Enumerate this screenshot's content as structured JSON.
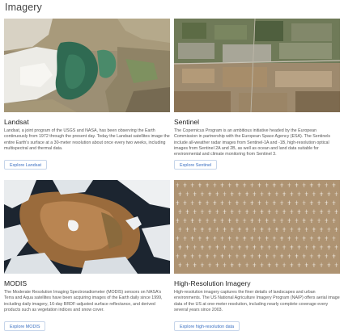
{
  "page": {
    "title": "Imagery"
  },
  "cards": [
    {
      "title": "Landsat",
      "image_subject": "Landsat satellite image of a lake with salt flats and green water",
      "description": "Landsat, a joint program of the USGS and NASA, has been observing the Earth continuously from 1972 through the present day. Today the Landsat satellites image the entire Earth's surface at a 30-meter resolution about once every two weeks, including multispectral and thermal data.",
      "button_label": "Explore Landsat"
    },
    {
      "title": "Sentinel",
      "image_subject": "Sentinel satellite image of a town with fields",
      "description": "The Copernicus Program is an ambitious initiative headed by the European Commission in partnership with the European Space Agency (ESA). The Sentinels include all-weather radar images from Sentinel-1A and -1B, high-resolution optical images from Sentinel 2A and 2B, as well as ocean and land data suitable for environmental and climate monitoring from Sentinel 3.",
      "button_label": "Explore Sentinel"
    },
    {
      "title": "MODIS",
      "image_subject": "MODIS satellite image of Africa and Europe with clouds",
      "description": "The Moderate Resolution Imaging Spectroradiometer (MODIS) sensors on NASA's Terra and Aqua satellites have been acquiring images of the Earth daily since 1999, including daily imagery, 16-day BRDF-adjusted surface reflectance, and derived products such as vegetation indices and snow cover.",
      "button_label": "Explore MODIS"
    },
    {
      "title": "High-Resolution Imagery",
      "image_subject": "High-resolution aerial image of an aircraft boneyard",
      "description": "High-resolution imagery captures the finer details of landscapes and urban environments. The US National Agriculture Imagery Program (NAIP) offers aerial image data of the US at one-meter resolution, including nearly complete coverage every several years since 2003.",
      "button_label": "Explore high-resolution data"
    }
  ],
  "colors": {
    "link": "#3a6fc2",
    "button_border": "#c6d5ea",
    "title": "#222222",
    "body_text": "#555555"
  }
}
